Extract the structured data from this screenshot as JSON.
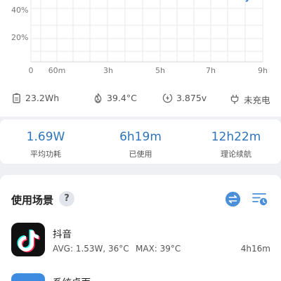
{
  "chart": {
    "y_ticks": [
      "40%",
      "20%"
    ],
    "x_ticks": [
      "0",
      "60m",
      "3h",
      "5h",
      "7h",
      "9h"
    ]
  },
  "battery_stats": {
    "capacity": "23.2Wh",
    "temperature": "39.4°C",
    "voltage": "3.875v",
    "charge_status": "未充电"
  },
  "summary": [
    {
      "value": "1.69W",
      "label": "平均功耗"
    },
    {
      "value": "6h19m",
      "label": "已使用"
    },
    {
      "value": "12h22m",
      "label": "理论续航"
    }
  ],
  "scenes": {
    "title": "使用场景",
    "help_symbol": "?",
    "apps": [
      {
        "name": "抖音",
        "avg": "AVG: 1.53W, 36°C",
        "max": "MAX:  39°C",
        "duration": "4h16m"
      },
      {
        "name": "系统桌面"
      }
    ]
  },
  "colors": {
    "accent": "#2f74b8",
    "icon_blue": "#4a8fd8",
    "background": "#eef0f3"
  }
}
